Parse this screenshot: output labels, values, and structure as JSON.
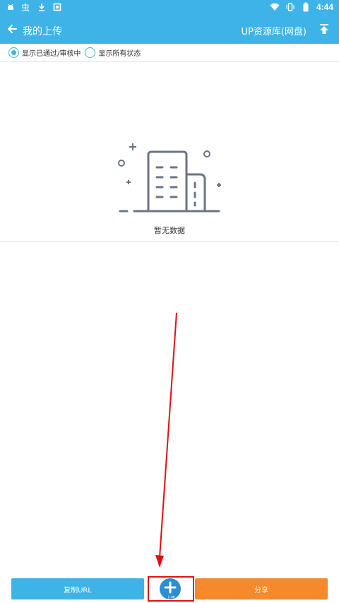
{
  "statusbar": {
    "time": "4:44",
    "icons": [
      "android-debug-icon",
      "bug-icon",
      "download-icon",
      "square-icon",
      "wifi-icon",
      "vibrate-icon",
      "battery-icon"
    ]
  },
  "appbar": {
    "title": "我的上传",
    "repo_link": "UP资源库(网盘)",
    "back_icon": "arrow-left-icon",
    "upload_icon": "upload-icon"
  },
  "filter": {
    "options": [
      {
        "label": "显示已通过/审核中",
        "selected": true
      },
      {
        "label": "显示所有状态",
        "selected": false
      }
    ]
  },
  "empty": {
    "text": "暂无数据",
    "icon": "building-icon"
  },
  "bottom": {
    "copy_label": "复制URL",
    "add_label": "上传",
    "share_label": "分享"
  },
  "colors": {
    "primary": "#3db3e8",
    "accent": "#f5892b",
    "highlight": "#e01010"
  }
}
